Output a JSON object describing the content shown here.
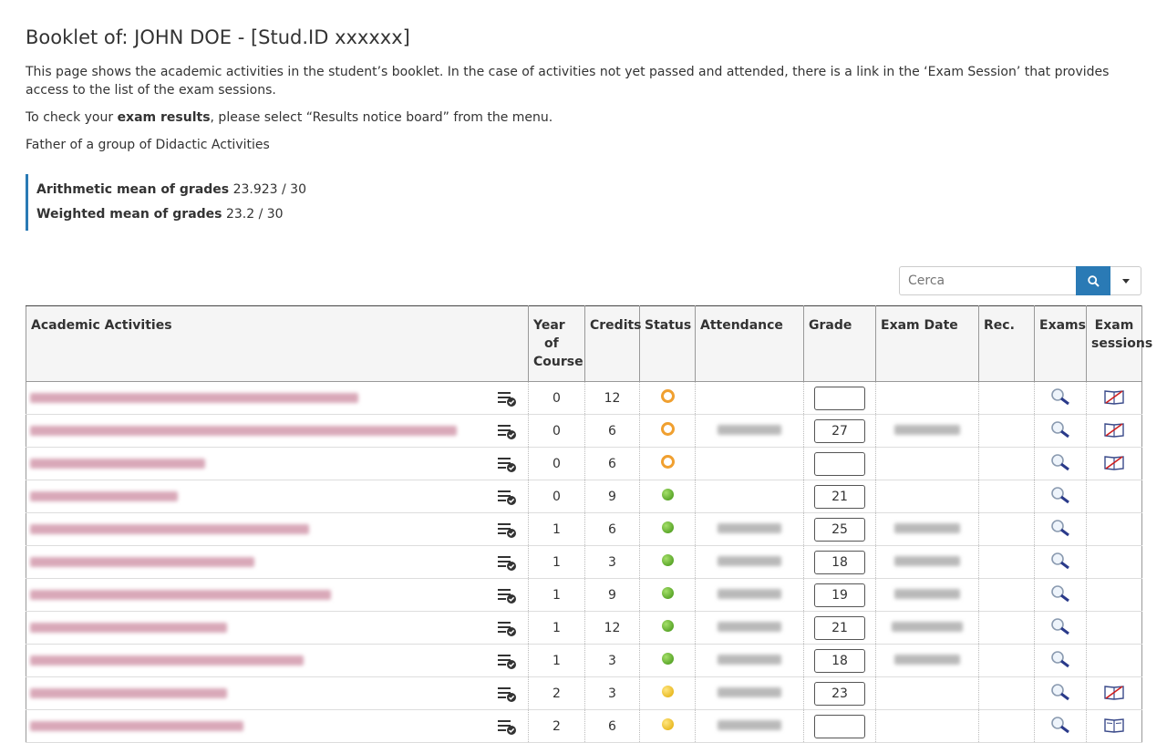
{
  "header": {
    "title": "Booklet of: JOHN DOE - [Stud.ID xxxxxx]",
    "intro": "This page shows the academic activities in the student’s booklet. In the case of activities not yet passed and attended, there is a link in the ‘Exam Session’ that provides access to the list of the exam sessions.",
    "check_prefix": "To check your ",
    "check_bold": "exam results",
    "check_suffix": ", please select “Results notice board” from the menu.",
    "father": "Father of a group of Didactic Activities"
  },
  "means": {
    "arith_label": "Arithmetic mean of grades",
    "arith_value": "23.923 / 30",
    "weighted_label": "Weighted mean of grades",
    "weighted_value": "23.2 / 30"
  },
  "search": {
    "placeholder": "Cerca"
  },
  "columns": {
    "activities": "Academic Activities",
    "year_a": "Year",
    "year_b": "of",
    "year_c": "Course",
    "credits": "Credits",
    "status": "Status",
    "attendance": "Attendance",
    "grade": "Grade",
    "exam_date": "Exam Date",
    "rec": "Rec.",
    "exams": "Exams",
    "sessions_a": "Exam",
    "sessions_b": "sessions"
  },
  "rows": [
    {
      "year": "0",
      "credits": "12",
      "status": "ring",
      "grade": "",
      "session_icon": "book-crossed-icon"
    },
    {
      "year": "0",
      "credits": "6",
      "status": "ring",
      "grade": "27",
      "session_icon": "book-crossed-icon"
    },
    {
      "year": "0",
      "credits": "6",
      "status": "ring",
      "grade": "",
      "session_icon": "book-crossed-icon"
    },
    {
      "year": "0",
      "credits": "9",
      "status": "green",
      "grade": "21",
      "session_icon": ""
    },
    {
      "year": "1",
      "credits": "6",
      "status": "green",
      "grade": "25",
      "session_icon": ""
    },
    {
      "year": "1",
      "credits": "3",
      "status": "green",
      "grade": "18",
      "session_icon": ""
    },
    {
      "year": "1",
      "credits": "9",
      "status": "green",
      "grade": "19",
      "session_icon": ""
    },
    {
      "year": "1",
      "credits": "12",
      "status": "green",
      "grade": "21",
      "session_icon": ""
    },
    {
      "year": "1",
      "credits": "3",
      "status": "green",
      "grade": "18",
      "session_icon": ""
    },
    {
      "year": "2",
      "credits": "3",
      "status": "yellow",
      "grade": "23",
      "session_icon": "book-crossed-icon"
    },
    {
      "year": "2",
      "credits": "6",
      "status": "yellow",
      "grade": "",
      "session_icon": "book-open-icon"
    }
  ],
  "colors": {
    "accent": "#2a7ab5",
    "ring": "#f0a030",
    "passed": "#3d8f10",
    "pending": "#e0a800"
  }
}
